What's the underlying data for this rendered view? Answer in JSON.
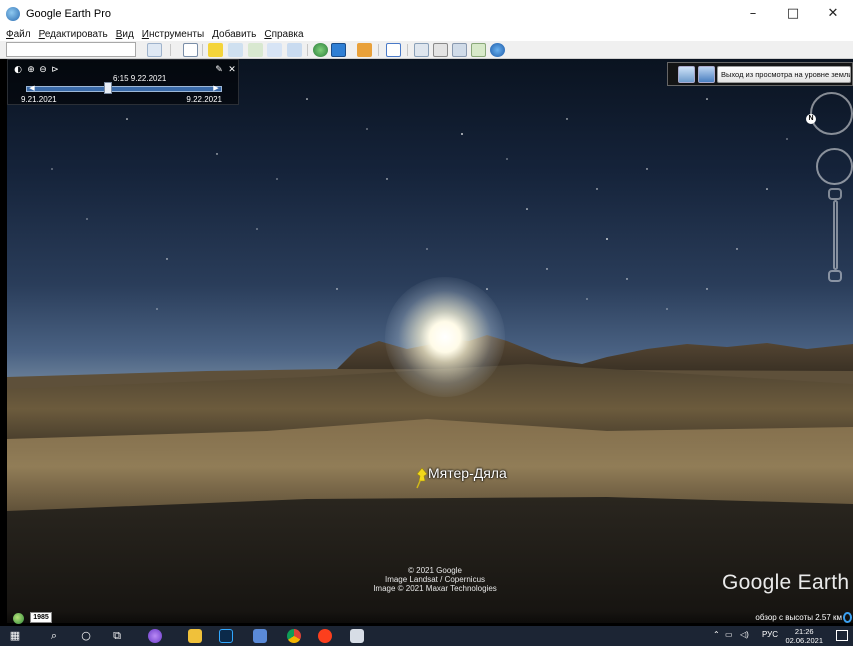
{
  "window": {
    "title": "Google Earth Pro",
    "controls": [
      "–",
      "□",
      "✕"
    ]
  },
  "menu": [
    "Файл",
    "Редактировать",
    "Вид",
    "Инструменты",
    "Добавить",
    "Справка"
  ],
  "toolbar": {
    "search_value": "",
    "buttons": [
      "search-icon",
      "sidebar-icon",
      "placemark-icon",
      "polygon-icon",
      "path-icon",
      "overlay-icon",
      "tour-icon",
      "history-icon",
      "sun-icon",
      "planets-icon",
      "ruler-icon",
      "email-icon",
      "print-icon",
      "save-image-icon",
      "maps-icon",
      "earth-icon"
    ]
  },
  "time_slider": {
    "current_label": "6:15 9.22.2021",
    "start_label": "9.21.2021",
    "end_label": "9.22.2021",
    "position": 0.42
  },
  "ground_view": {
    "exit_label": "Выход из просмотра на уровне земли"
  },
  "navigation": {
    "north_label": "N"
  },
  "placemark": {
    "label": "Мятер-Дяла"
  },
  "attribution": {
    "line1": "© 2021 Google",
    "line2": "Image Landsat / Copernicus",
    "line3": "Image © 2021 Maxar Technologies"
  },
  "brand": "Google Earth",
  "status": {
    "imagery_year": "1985",
    "altitude": "обзор с высоты   2.57 км"
  },
  "taskbar": {
    "language": "РУС",
    "time": "21:26",
    "date": "02.06.2021",
    "apps": [
      "windows-start",
      "search",
      "cortana",
      "task-view",
      "alice",
      "file-explorer",
      "photoshop",
      "edge-app",
      "chrome",
      "yandex-browser",
      "network-app"
    ]
  },
  "colors": {
    "sky_top": "#0a1320",
    "sky_horizon": "#6a7f98",
    "dune": "#6d5a3c",
    "taskbar": "#1c2534",
    "pin": "#f2d81b"
  }
}
